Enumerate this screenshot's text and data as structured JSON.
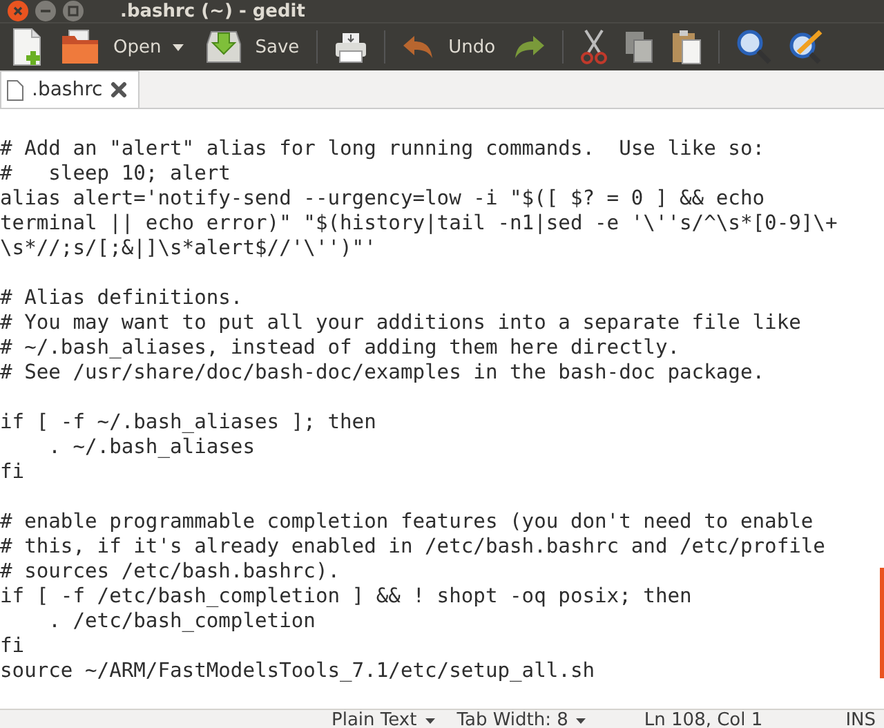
{
  "window": {
    "title": ".bashrc (~) - gedit"
  },
  "toolbar": [
    {
      "kind": "new"
    },
    {
      "kind": "open",
      "label": "Open"
    },
    {
      "kind": "dropdown"
    },
    {
      "kind": "save",
      "label": "Save"
    },
    {
      "kind": "separator"
    },
    {
      "kind": "print"
    },
    {
      "kind": "separator"
    },
    {
      "kind": "undo",
      "label": "Undo"
    },
    {
      "kind": "redo"
    },
    {
      "kind": "separator"
    },
    {
      "kind": "cut"
    },
    {
      "kind": "copy"
    },
    {
      "kind": "paste"
    },
    {
      "kind": "separator"
    },
    {
      "kind": "search"
    },
    {
      "kind": "replace"
    }
  ],
  "tabs": [
    {
      "label": ".bashrc",
      "selected": true
    }
  ],
  "editor": {
    "blocks": [
      [
        "# Add an \"alert\" alias for long running commands.  Use like so:",
        "#   sleep 10; alert",
        "alias alert='notify-send --urgency=low -i \"$([ $? = 0 ] && echo",
        "terminal || echo error)\" \"$(history|tail -n1|sed -e '\\''s/^\\s*[0-9]\\+",
        "\\s*//;s/[;&|]\\s*alert$//'\\'')\"'"
      ],
      [
        "# Alias definitions.",
        "# You may want to put all your additions into a separate file like",
        "# ~/.bash_aliases, instead of adding them here directly.",
        "# See /usr/share/doc/bash-doc/examples in the bash-doc package."
      ],
      [
        "if [ -f ~/.bash_aliases ]; then",
        "    . ~/.bash_aliases",
        "fi"
      ],
      [
        "# enable programmable completion features (you don't need to enable",
        "# this, if it's already enabled in /etc/bash.bashrc and /etc/profile",
        "# sources /etc/bash.bashrc).",
        "if [ -f /etc/bash_completion ] && ! shopt -oq posix; then",
        "    . /etc/bash_completion",
        "fi",
        "source ~/ARM/FastModelsTools_7.1/etc/setup_all.sh"
      ]
    ]
  },
  "status_bar": {
    "language": "Plain Text",
    "tab_width": "Tab Width: 8",
    "position": "Ln 108, Col 1",
    "mode": "INS"
  }
}
